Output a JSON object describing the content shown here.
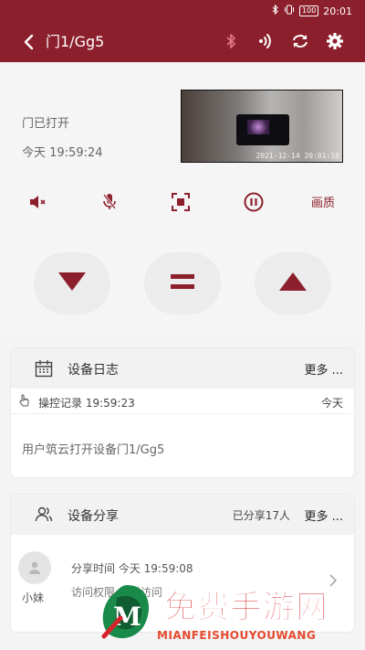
{
  "statusbar": {
    "battery": "100",
    "time": "20:01"
  },
  "appbar": {
    "title": "门1/Gg5",
    "icons": [
      "back-icon",
      "bluetooth-icon",
      "signal-icon",
      "refresh-icon",
      "settings-gear-icon"
    ]
  },
  "door": {
    "status": "门已打开",
    "time": "今天 19:59:24",
    "video_timestamp": "2021-12-14 20:01:18"
  },
  "controls": {
    "icons": [
      "speaker-mute-icon",
      "mic-mute-icon",
      "screenshot-icon",
      "pause-icon"
    ],
    "quality_label": "画质"
  },
  "motion": {
    "icons": [
      "arrow-down-icon",
      "stop-equal-icon",
      "arrow-up-icon"
    ]
  },
  "log_card": {
    "title": "设备日志",
    "more": "更多 ...",
    "row_label": "操控记录 19:59:23",
    "row_day": "今天",
    "message": "用户筑云打开设备门1/Gg5"
  },
  "share_card": {
    "title": "设备分享",
    "count": "已分享17人",
    "more": "更多 ...",
    "user_name": "小妹",
    "share_time": "分享时间   今天 19:59:08",
    "access_time": "访问权限   全时访问"
  },
  "watermark": {
    "title": "免费手游网",
    "subtitle": "MIANFEISHOUYOUWANG"
  },
  "colors": {
    "brand": "#8c1f2c",
    "background": "#f4f4f4",
    "watermark": "#d8232a"
  }
}
